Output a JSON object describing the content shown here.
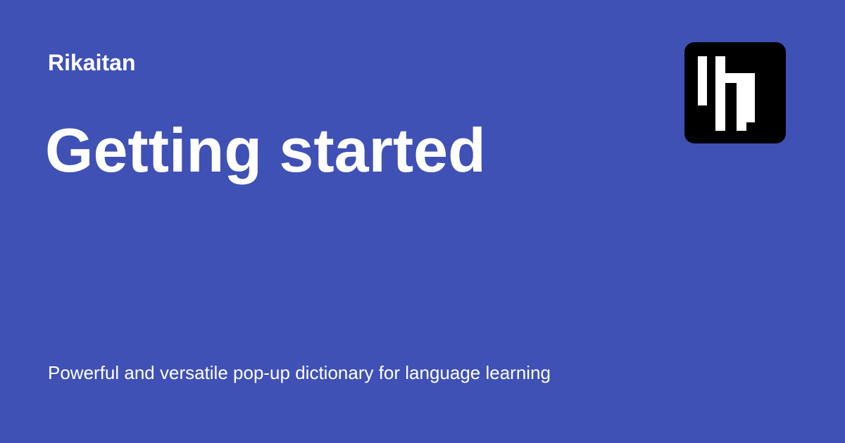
{
  "header": {
    "site_name": "Rikaitan",
    "logo_icon": "rikaitan-logo-icon"
  },
  "main": {
    "title": "Getting started",
    "tagline": "Powerful and versatile pop-up dictionary for language learning"
  },
  "colors": {
    "background": "#3f51b5",
    "text": "#ffffff",
    "logo_background": "#000000",
    "logo_foreground": "#ffffff"
  }
}
